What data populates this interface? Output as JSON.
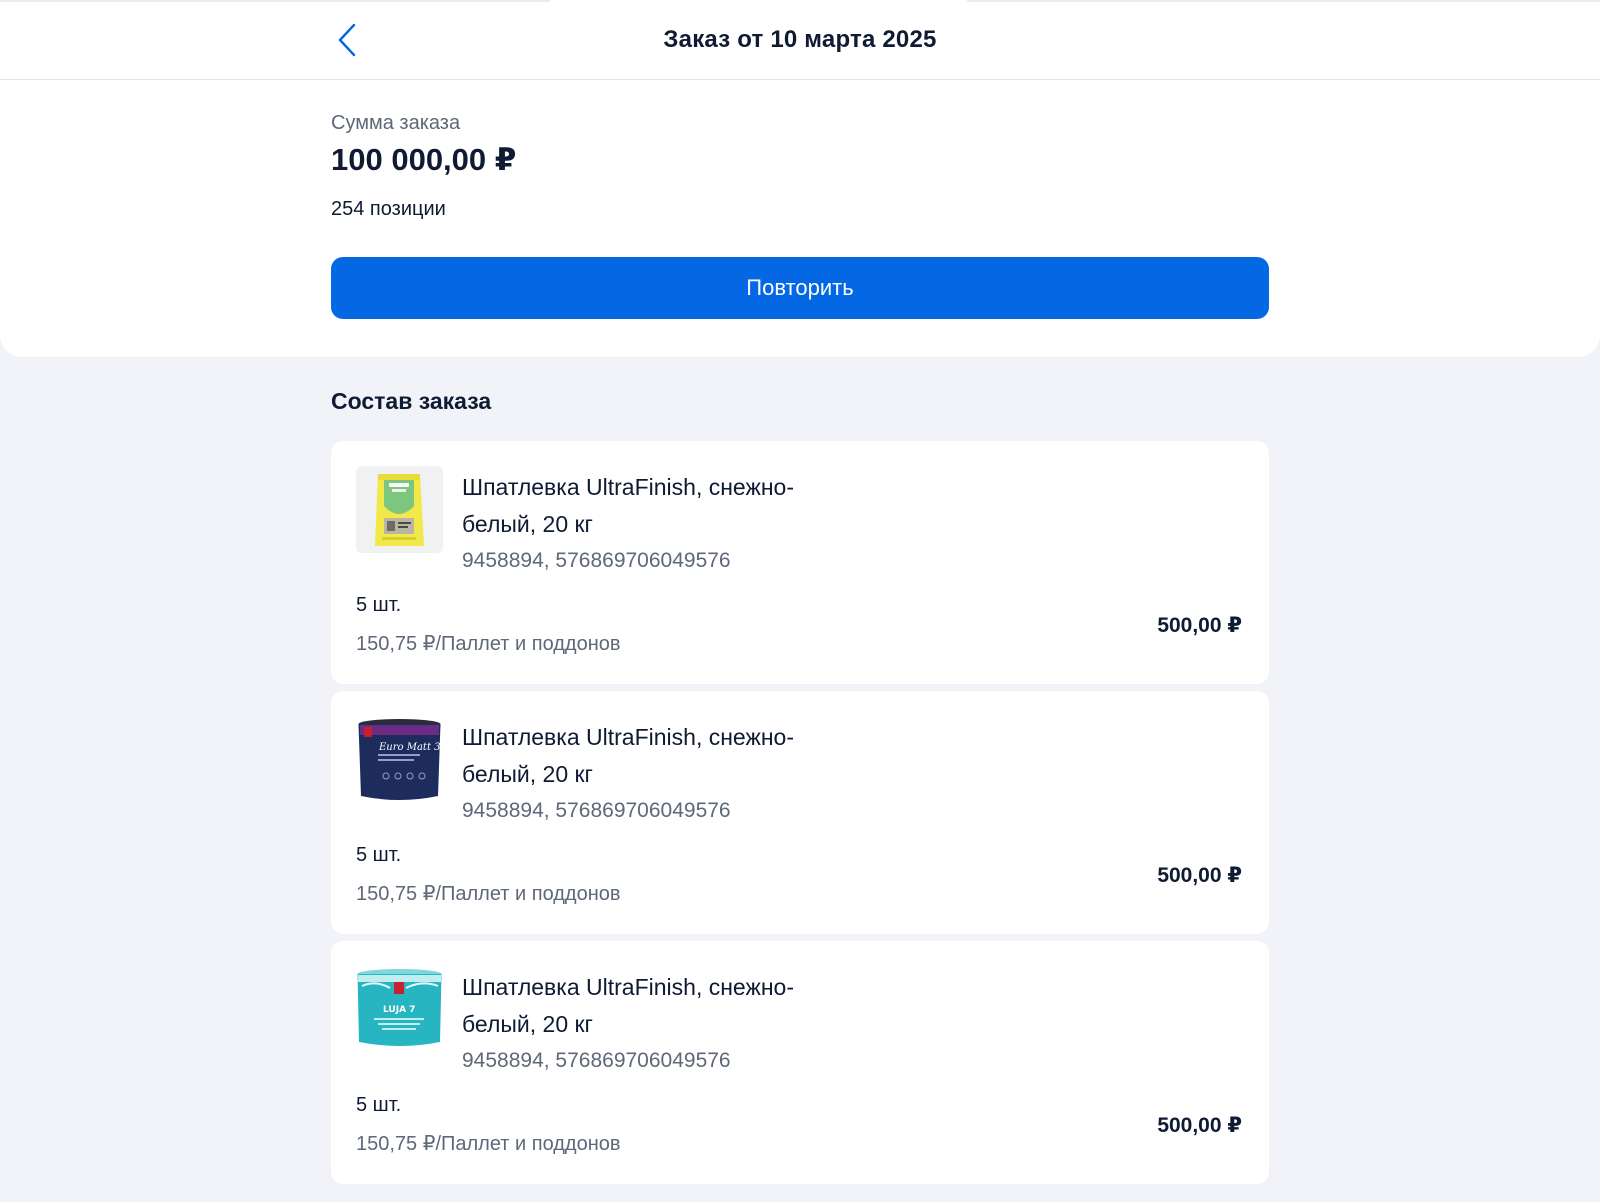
{
  "header": {
    "title": "Заказ от 10 марта 2025",
    "back_icon": "chevron-left-icon",
    "accent_color": "#0468e4"
  },
  "summary": {
    "label": "Сумма заказа",
    "total": "100 000,00 ₽",
    "positions": "254 позиции",
    "repeat_button": "Повторить"
  },
  "order_items": {
    "title": "Состав заказа",
    "items": [
      {
        "name": "Шпатлевка UltraFinish, снежно-белый, 20 кг",
        "codes": "9458894, 576869706049576",
        "quantity": "5 шт.",
        "unit_price": "150,75 ₽/Паллет и поддонов",
        "total": "500,00 ₽",
        "image": "vetonit-lr-plus-bag"
      },
      {
        "name": "Шпатлевка UltraFinish, снежно-белый, 20 кг",
        "codes": "9458894, 576869706049576",
        "quantity": "5 шт.",
        "unit_price": "150,75 ₽/Паллет и поддонов",
        "total": "500,00 ₽",
        "image": "euro-matt-3-paint-bucket",
        "image_label": "Euro Matt 3"
      },
      {
        "name": "Шпатлевка UltraFinish, снежно-белый, 20 кг",
        "codes": "9458894, 576869706049576",
        "quantity": "5 шт.",
        "unit_price": "150,75 ₽/Паллет и поддонов",
        "total": "500,00 ₽",
        "image": "luja-7-paint-bucket",
        "image_label": "LUJA 7"
      }
    ]
  }
}
